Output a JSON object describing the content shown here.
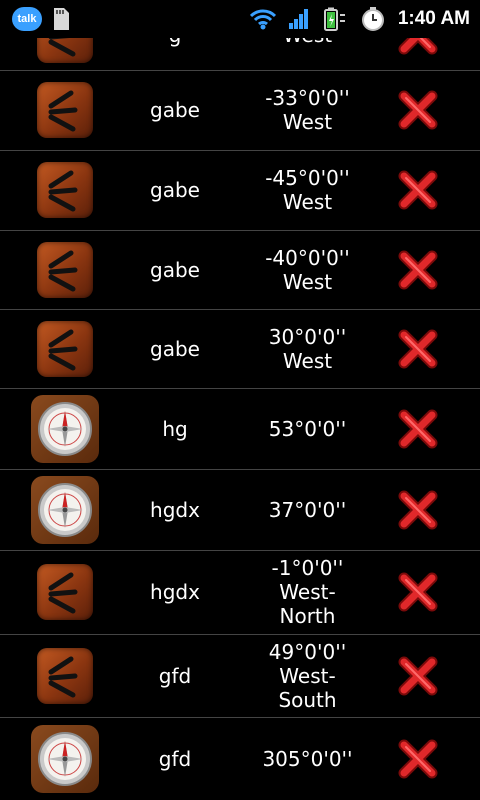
{
  "status_bar": {
    "talk_label": "talk",
    "time": "1:40 AM"
  },
  "colors": {
    "background": "#000000",
    "divider": "#444444",
    "delete_red": "#e0282a",
    "wood": "#a84818"
  },
  "rows": [
    {
      "icon": "wood-lines-icon",
      "name": "g",
      "coord": "West"
    },
    {
      "icon": "wood-lines-icon",
      "name": "gabe",
      "coord": "-33°0'0''\nWest"
    },
    {
      "icon": "wood-lines-icon",
      "name": "gabe",
      "coord": "-45°0'0''\nWest"
    },
    {
      "icon": "wood-lines-icon",
      "name": "gabe",
      "coord": "-40°0'0''\nWest"
    },
    {
      "icon": "wood-lines-icon",
      "name": "gabe",
      "coord": "30°0'0''\nWest"
    },
    {
      "icon": "compass-icon",
      "name": "hg",
      "coord": "53°0'0''"
    },
    {
      "icon": "compass-icon",
      "name": "hgdx",
      "coord": "37°0'0''"
    },
    {
      "icon": "wood-lines-icon",
      "name": "hgdx",
      "coord": "-1°0'0''\nWest-\nNorth"
    },
    {
      "icon": "wood-lines-icon",
      "name": "gfd",
      "coord": "49°0'0''\nWest-\nSouth"
    },
    {
      "icon": "compass-icon",
      "name": "gfd",
      "coord": "305°0'0''"
    }
  ]
}
